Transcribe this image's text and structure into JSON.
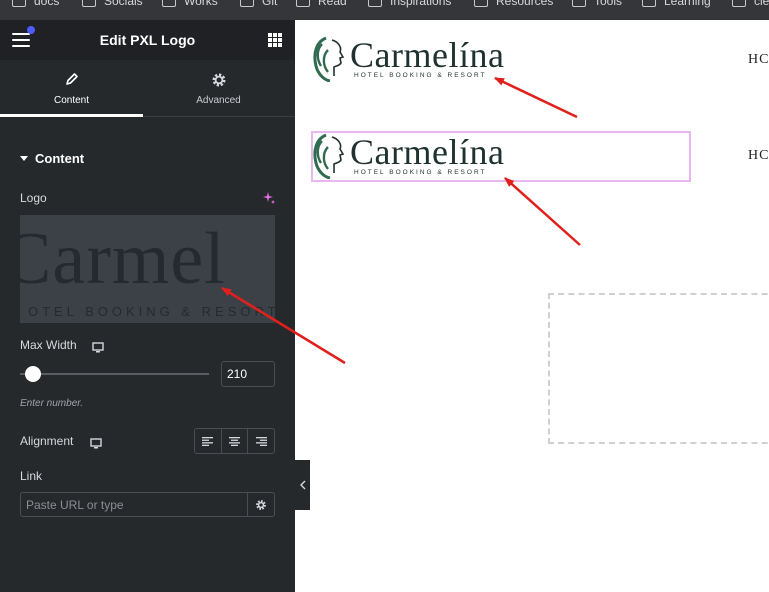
{
  "bookmarks": [
    "docs",
    "Socials",
    "Works",
    "Git",
    "Read",
    "Inspirations",
    "Resources",
    "Tools",
    "Learning",
    "cle"
  ],
  "panel": {
    "title": "Edit PXL Logo",
    "tabs": [
      {
        "label": "Content",
        "icon": "pencil-icon",
        "active": true
      },
      {
        "label": "Advanced",
        "icon": "gear-icon",
        "active": false
      }
    ],
    "section_title": "Content",
    "logo_label": "Logo",
    "logo_preview": {
      "text": "Carmel",
      "subtext": "OTEL BOOKING & RESORT"
    },
    "max_width_label": "Max Width",
    "max_width_value": "210",
    "max_width_hint": "Enter number.",
    "alignment_label": "Alignment",
    "link_label": "Link",
    "link_placeholder": "Paste URL or type"
  },
  "canvas": {
    "logo_word": "Carmelína",
    "logo_tagline": "HOTEL BOOKING & RESORT",
    "nav_text": "HC"
  },
  "colors": {
    "panel_bg": "#26292c",
    "header_bg": "#1f2124",
    "selection_border": "#e9b7f0",
    "annotation_arrow": "#e0201c",
    "logo_green": "#1f3230"
  }
}
